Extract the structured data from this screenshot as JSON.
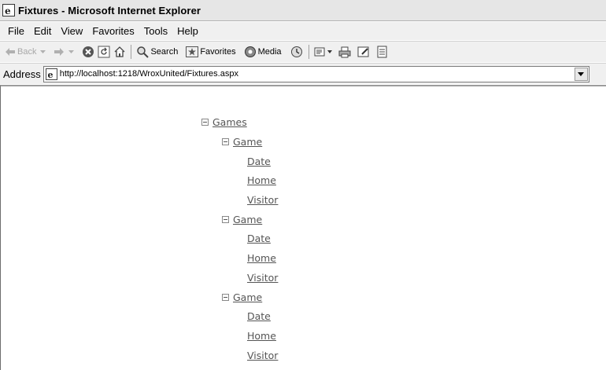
{
  "window": {
    "title": "Fixtures - Microsoft Internet Explorer"
  },
  "menu": {
    "items": [
      "File",
      "Edit",
      "View",
      "Favorites",
      "Tools",
      "Help"
    ]
  },
  "toolbar": {
    "back_label": "Back",
    "search_label": "Search",
    "favorites_label": "Favorites",
    "media_label": "Media"
  },
  "address": {
    "label": "Address",
    "url": "http://localhost:1218/WroxUnited/Fixtures.aspx"
  },
  "tree": {
    "root": {
      "label": "Games",
      "expanded": true
    },
    "games": [
      {
        "label": "Game",
        "expanded": true,
        "children": [
          "Date",
          "Home",
          "Visitor"
        ]
      },
      {
        "label": "Game",
        "expanded": true,
        "children": [
          "Date",
          "Home",
          "Visitor"
        ]
      },
      {
        "label": "Game",
        "expanded": true,
        "children": [
          "Date",
          "Home",
          "Visitor"
        ]
      }
    ]
  }
}
